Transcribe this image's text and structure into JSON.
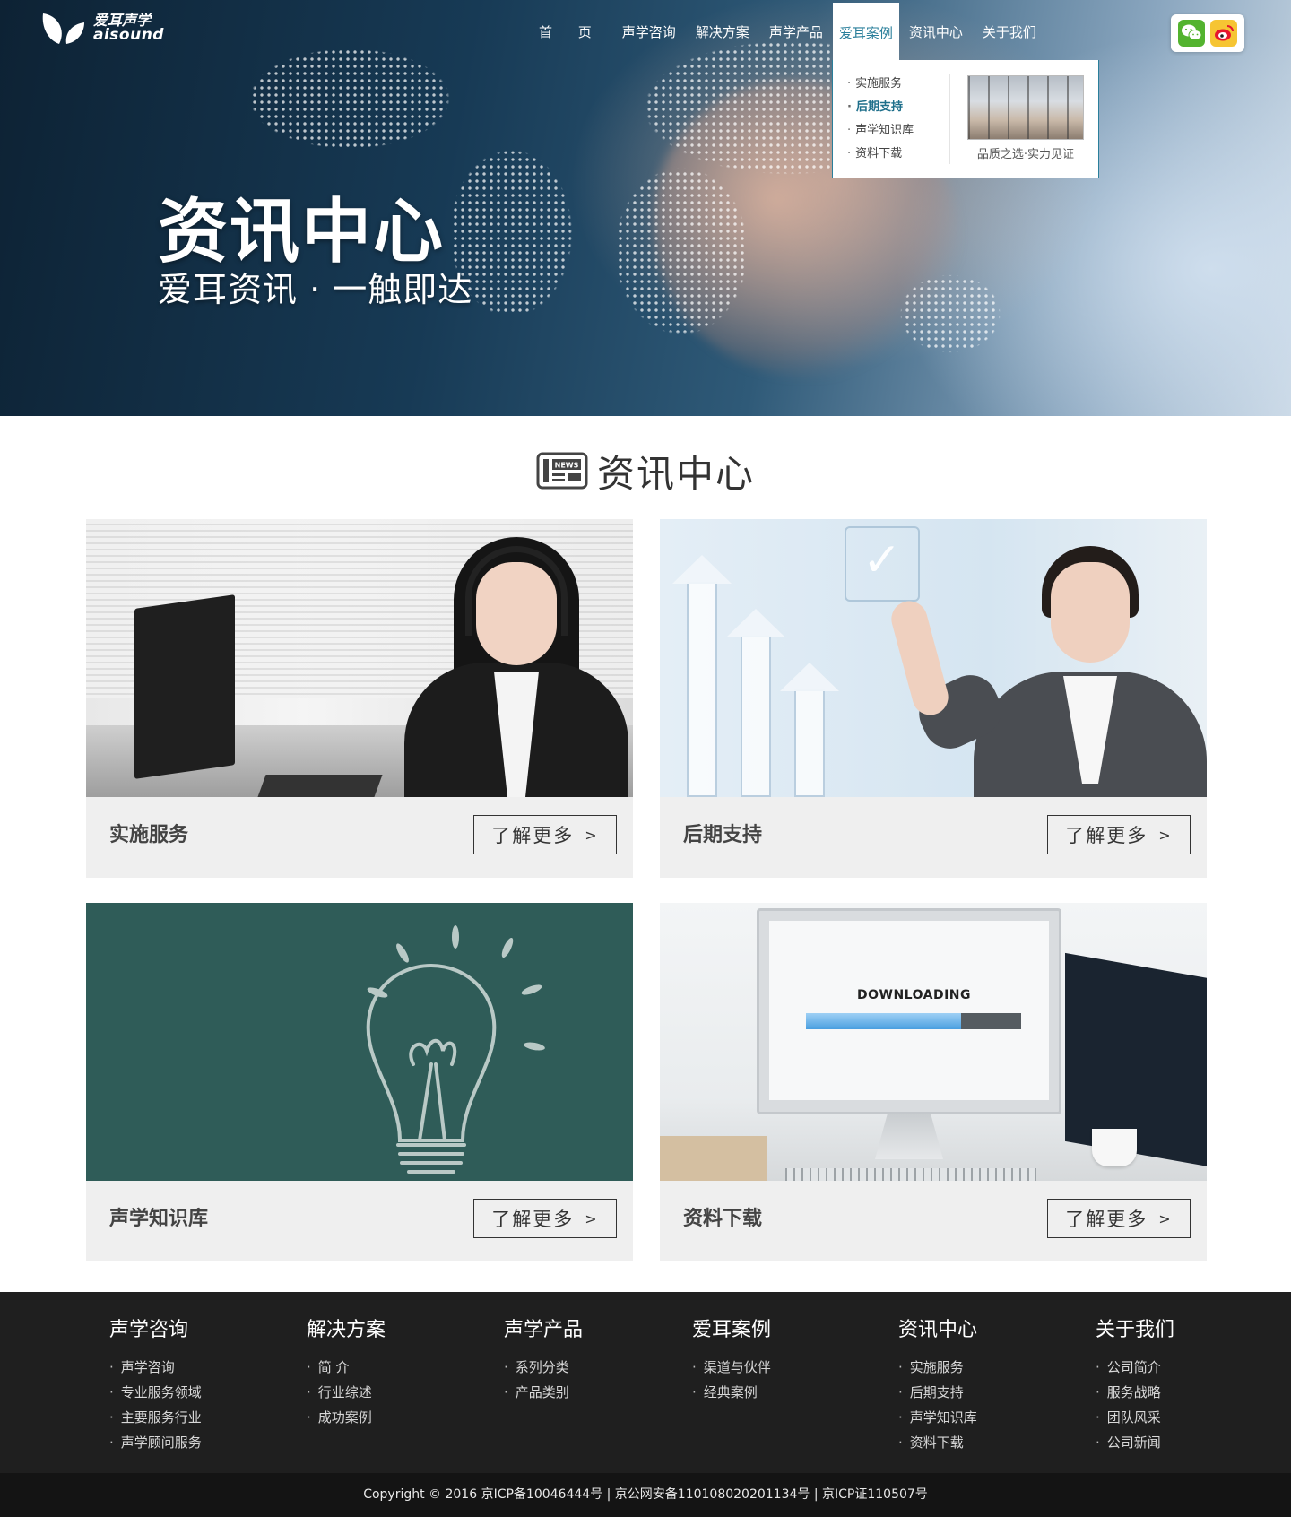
{
  "logo": {
    "cn": "爱耳声学",
    "en": "aisound"
  },
  "nav": {
    "items": [
      {
        "label": "首 页"
      },
      {
        "label": "声学咨询"
      },
      {
        "label": "解决方案"
      },
      {
        "label": "声学产品"
      },
      {
        "label": "爱耳案例"
      },
      {
        "label": "资讯中心"
      },
      {
        "label": "关于我们"
      }
    ],
    "active_index": 4
  },
  "social": {
    "wechat": "wechat-icon",
    "weibo": "weibo-icon"
  },
  "dropdown": {
    "items": [
      "实施服务",
      "后期支持",
      "声学知识库",
      "资料下载"
    ],
    "highlighted": "后期支持",
    "caption": "品质之选·实力见证"
  },
  "hero": {
    "title": "资讯中心",
    "subtitle": "爱耳资讯 · 一触即达"
  },
  "section": {
    "title": "资讯中心",
    "icon_text": "NEWS"
  },
  "cards": [
    {
      "label": "实施服务",
      "button": "了解更多"
    },
    {
      "label": "后期支持",
      "button": "了解更多"
    },
    {
      "label": "声学知识库",
      "button": "了解更多"
    },
    {
      "label": "资料下载",
      "button": "了解更多",
      "screen_text": "DOWNLOADING",
      "progress": 0.72
    }
  ],
  "footer": {
    "columns": [
      {
        "title": "声学咨询",
        "links": [
          "声学咨询",
          "专业服务领域",
          "主要服务行业",
          "声学顾问服务"
        ]
      },
      {
        "title": "解决方案",
        "links": [
          "简 介",
          "行业综述",
          "成功案例"
        ]
      },
      {
        "title": "声学产品",
        "links": [
          "系列分类",
          "产品类别"
        ]
      },
      {
        "title": "爱耳案例",
        "links": [
          "渠道与伙伴",
          "经典案例"
        ]
      },
      {
        "title": "资讯中心",
        "links": [
          "实施服务",
          "后期支持",
          "声学知识库",
          "资料下载"
        ]
      },
      {
        "title": "关于我们",
        "links": [
          "公司简介",
          "服务战略",
          "团队风采",
          "公司新闻"
        ]
      }
    ],
    "copyright": "Copyright © 2016  京ICP备10046444号 | 京公网安备110108020201134号 | 京ICP证110507号"
  },
  "colors": {
    "accent": "#2a7f9b",
    "footer_bg": "#1f1f1f",
    "copyright_bg": "#141414",
    "card_bg": "#efefef",
    "chalkboard": "#2f5c58",
    "wechat": "#53b32f",
    "weibo": "#f6c533"
  }
}
